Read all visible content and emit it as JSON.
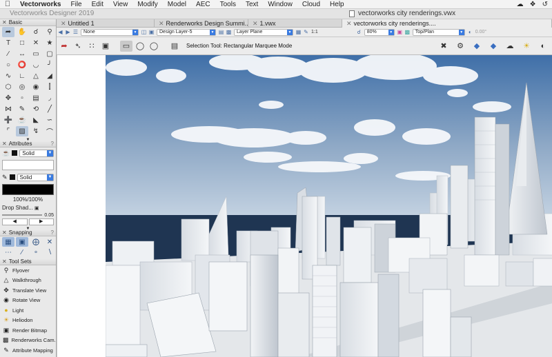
{
  "menubar": {
    "app_name": "Vectorworks",
    "items": [
      "File",
      "Edit",
      "View",
      "Modify",
      "Model",
      "AEC",
      "Tools",
      "Text",
      "Window",
      "Cloud",
      "Help"
    ]
  },
  "titlebar": {
    "app_title": "Vectorworks Designer 2019",
    "document_title": "vectorworks city renderings.vwx"
  },
  "tabs": [
    {
      "label": "Untitled 1",
      "active": false
    },
    {
      "label": "Renderworks Design Summi...",
      "active": false
    },
    {
      "label": "1.vwx",
      "active": false
    },
    {
      "label": "vectorworks city renderings....",
      "active": true
    }
  ],
  "view_bar": {
    "class_value": "None",
    "layer_value": "Design Layer-5",
    "plane_value": "Layer Plane",
    "scale_value": "1:1",
    "zoom_value": "80%",
    "view_value": "Top/Plan",
    "rotation_value": "0.00°"
  },
  "mode_bar": {
    "mode_label": "Selection Tool: Rectangular Marquee Mode"
  },
  "palettes": {
    "basic_title": "Basic",
    "attributes_title": "Attributes",
    "fill_style": "Solid",
    "pen_style": "Solid",
    "opacity": "100%/100%",
    "drop_shadow_label": "Drop Shad...",
    "line_weight": "0.05",
    "snapping_title": "Snapping",
    "toolsets_title": "Tool Sets"
  },
  "toolset_items": [
    {
      "label": "Flyover",
      "icon": "flyover-icon"
    },
    {
      "label": "Walkthrough",
      "icon": "walkthrough-icon"
    },
    {
      "label": "Translate View",
      "icon": "translate-view-icon"
    },
    {
      "label": "Rotate View",
      "icon": "rotate-view-icon"
    },
    {
      "label": "Light",
      "icon": "light-icon"
    },
    {
      "label": "Heliodon",
      "icon": "heliodon-icon"
    },
    {
      "label": "Render Bitmap",
      "icon": "render-bitmap-icon"
    },
    {
      "label": "Renderworks Cam...",
      "icon": "renderworks-camera-icon"
    },
    {
      "label": "Attribute Mapping",
      "icon": "attribute-mapping-icon"
    }
  ],
  "colors": {
    "sky_top": "#3f6fa8",
    "sky_bottom": "#c6d4e3",
    "sea": "#1f3552",
    "selection_blue": "#3a7be0"
  }
}
